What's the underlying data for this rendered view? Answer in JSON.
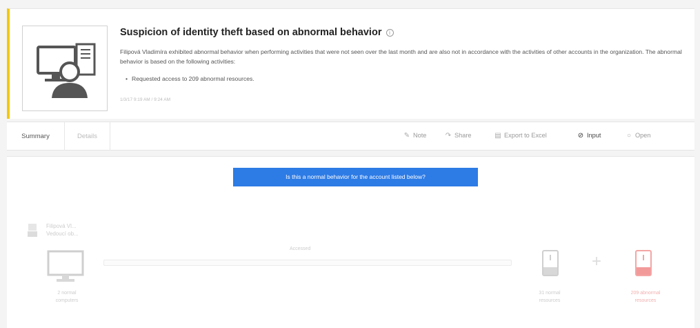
{
  "alert": {
    "title": "Suspicion of identity theft based on abnormal behavior",
    "info_icon": "info-icon",
    "description": "Filipová Vladimíra exhibited abnormal behavior when performing activities that were not seen over the last month and are also not in accordance with the activities of other accounts in the organization. The abnormal behavior is based on the following activities:",
    "bullet": "Requested access to 209 abnormal resources.",
    "timestamp": "1/3/17 9:19 AM / 9:24 AM",
    "accent_color": "#f2c811"
  },
  "tabs": [
    {
      "label": "Summary"
    },
    {
      "label": "Details"
    }
  ],
  "actions": [
    {
      "label": "Note",
      "icon": "pencil-icon"
    },
    {
      "label": "Share",
      "icon": "share-icon"
    },
    {
      "label": "Export to Excel",
      "icon": "excel-icon"
    },
    {
      "label": "Input",
      "icon": "input-icon"
    },
    {
      "label": "Open",
      "icon": "open-icon"
    }
  ],
  "main": {
    "question": "Is this a normal behavior for the account listed below?",
    "question_color": "#2d7be5",
    "account_name_line1": "Filipová Vl...",
    "account_name_line2": "Vedoucí ob...",
    "resources_label": "Accessed",
    "computers_line1": "2 normal",
    "computers_line2": "computers",
    "res_normal_line1": "31 normal",
    "res_normal_line2": "resources",
    "res_abnormal_line1": "209 abnormal",
    "res_abnormal_line2": "resources",
    "abnormal_color": "#e84c4c"
  }
}
